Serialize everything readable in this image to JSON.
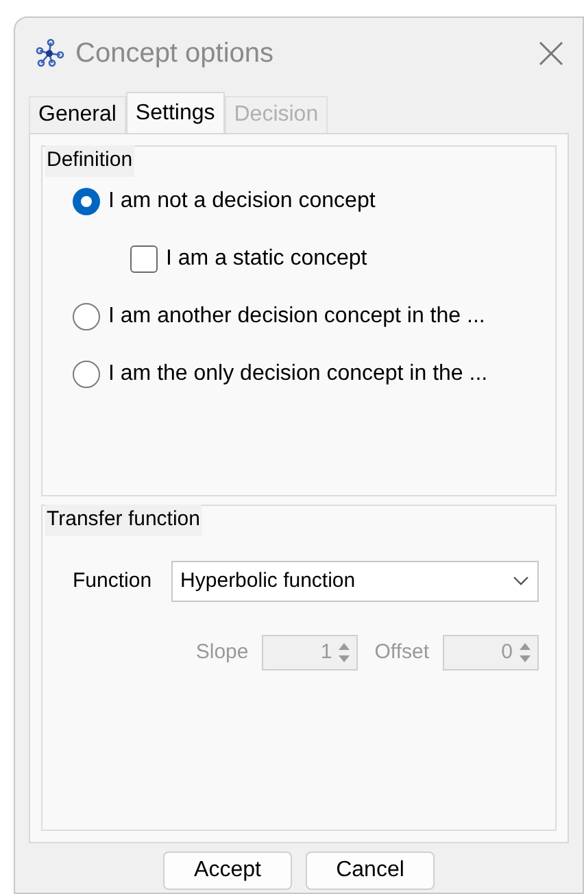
{
  "window": {
    "title": "Concept options"
  },
  "tabs": [
    {
      "label": "General",
      "selected": false,
      "disabled": false
    },
    {
      "label": "Settings",
      "selected": true,
      "disabled": false
    },
    {
      "label": "Decision",
      "selected": false,
      "disabled": true
    }
  ],
  "definition": {
    "title": "Definition",
    "options": [
      {
        "kind": "radio",
        "label": "I am not a decision concept",
        "selected": true
      },
      {
        "kind": "checkbox",
        "label": "I am a static concept",
        "checked": false
      },
      {
        "kind": "radio",
        "label": "I am another decision concept in the ...",
        "selected": false
      },
      {
        "kind": "radio",
        "label": "I am the only decision concept in the ...",
        "selected": false
      }
    ]
  },
  "transfer": {
    "title": "Transfer function",
    "function_label": "Function",
    "function_value": "Hyperbolic function",
    "spinners": [
      {
        "label": "Slope",
        "value": "1",
        "disabled": true
      },
      {
        "label": "Offset",
        "value": "0",
        "disabled": true
      }
    ]
  },
  "buttons": [
    "Accept",
    "Cancel"
  ]
}
